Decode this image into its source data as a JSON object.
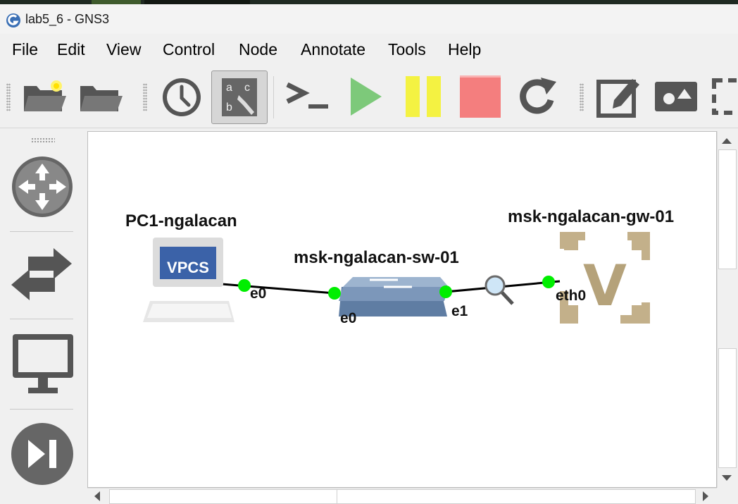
{
  "window": {
    "title": "lab5_6 - GNS3"
  },
  "menu": [
    "File",
    "Edit",
    "View",
    "Control",
    "Node",
    "Annotate",
    "Tools",
    "Help"
  ],
  "toolbar": {
    "buttons": [
      "open-project-icon",
      "open-folder-icon",
      "snapshot-clock-icon",
      "show-interface-labels-icon",
      "console-icon",
      "start-icon",
      "suspend-icon",
      "stop-icon",
      "reload-icon",
      "add-note-icon",
      "insert-picture-icon",
      "draw-rectangle-icon"
    ],
    "colors": {
      "start": "#7dc97a",
      "suspend": "#f4f242",
      "stop": "#f47e7e"
    }
  },
  "dock": [
    "routers-icon",
    "switches-icon",
    "end-devices-icon",
    "all-devices-icon"
  ],
  "topology": {
    "nodes": [
      {
        "label": "PC1-ngalacan",
        "icon_text": "VPCS",
        "type": "vpcs"
      },
      {
        "label": "msk-ngalacan-sw-01",
        "type": "switch"
      },
      {
        "label": "msk-ngalacan-gw-01",
        "icon_text": "V",
        "type": "vyos"
      }
    ],
    "ports": {
      "pc_e0": "e0",
      "sw_e0": "e0",
      "sw_e1": "e1",
      "gw_eth0": "eth0"
    },
    "link_status_color": "#00ee00"
  }
}
